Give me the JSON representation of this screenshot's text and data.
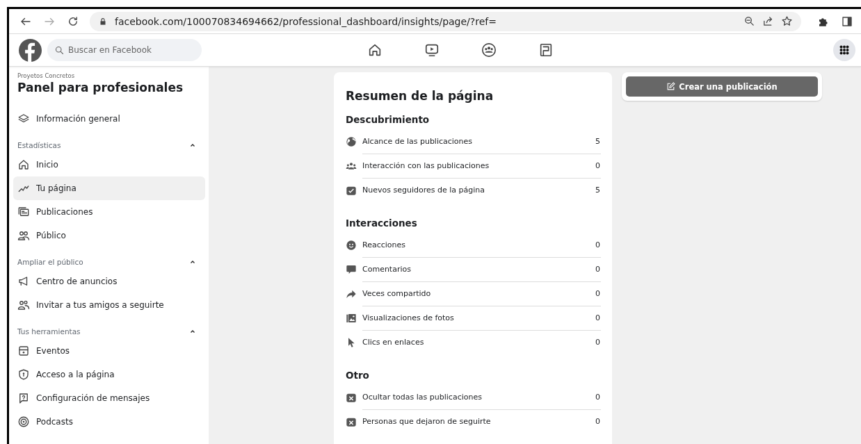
{
  "browser": {
    "url": "facebook.com/100070834694662/professional_dashboard/insights/page/?ref="
  },
  "header": {
    "search": {
      "placeholder": "Buscar en Facebook"
    }
  },
  "sidebar": {
    "page_name": "Proyetos Concretos",
    "title": "Panel para profesionales",
    "top_items": [
      {
        "label": "Información general",
        "selected": false
      }
    ],
    "sections": [
      {
        "heading": "Estadísticas",
        "expanded": true,
        "items": [
          {
            "label": "Inicio",
            "selected": false
          },
          {
            "label": "Tu página",
            "selected": true
          },
          {
            "label": "Publicaciones",
            "selected": false
          },
          {
            "label": "Público",
            "selected": false
          }
        ]
      },
      {
        "heading": "Ampliar el público",
        "expanded": true,
        "items": [
          {
            "label": "Centro de anuncios",
            "selected": false
          },
          {
            "label": "Invitar a tus amigos a seguirte",
            "selected": false
          }
        ]
      },
      {
        "heading": "Tus herramientas",
        "expanded": true,
        "items": [
          {
            "label": "Eventos",
            "selected": false
          },
          {
            "label": "Acceso a la página",
            "selected": false
          },
          {
            "label": "Configuración de mensajes",
            "selected": false
          },
          {
            "label": "Podcasts",
            "selected": false
          }
        ]
      }
    ]
  },
  "summary": {
    "title": "Resumen de la página",
    "sections": [
      {
        "heading": "Descubrimiento",
        "rows": [
          {
            "label": "Alcance de las publicaciones",
            "value": "5"
          },
          {
            "label": "Interacción con las publicaciones",
            "value": "0"
          },
          {
            "label": "Nuevos seguidores de la página",
            "value": "5"
          }
        ]
      },
      {
        "heading": "Interacciones",
        "rows": [
          {
            "label": "Reacciones",
            "value": "0"
          },
          {
            "label": "Comentarios",
            "value": "0"
          },
          {
            "label": "Veces compartido",
            "value": "0"
          },
          {
            "label": "Visualizaciones de fotos",
            "value": "0"
          },
          {
            "label": "Clics en enlaces",
            "value": "0"
          }
        ]
      },
      {
        "heading": "Otro",
        "rows": [
          {
            "label": "Ocultar todas las publicaciones",
            "value": "0"
          },
          {
            "label": "Personas que dejaron de seguirte",
            "value": "0"
          }
        ]
      }
    ]
  },
  "create_button": {
    "label": "Crear una publicación"
  }
}
